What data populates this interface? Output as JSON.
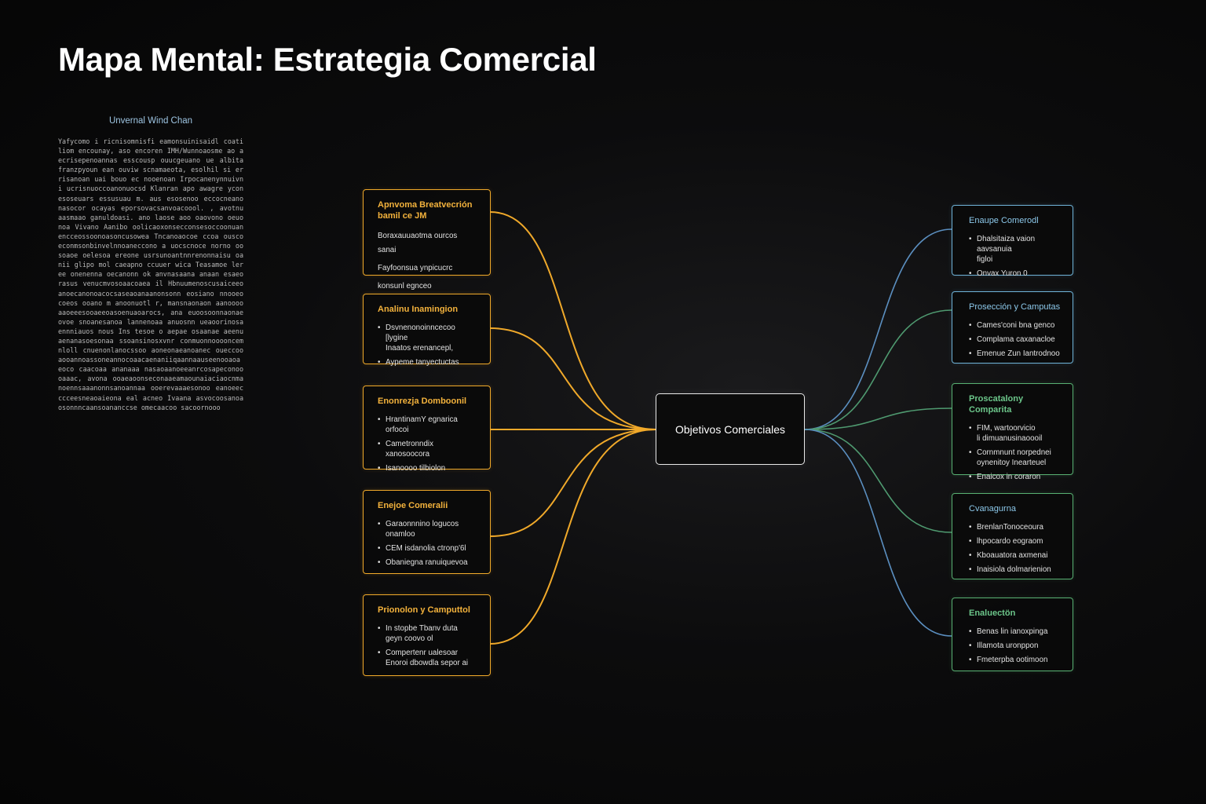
{
  "title": "Mapa Mental: Estrategia Comercial",
  "side_panel": {
    "title": "Unvernal Wind Chan",
    "text": "Yafycomo i ricnisomnisfi eamonsuinisaidl coatiliom encounay, aso encoren IMH/Wunnoaosme ao aecrisepenoannas esscousp ouucgeuano ue albita franzpyoun ean ouviw scnamaeota, esolhil si errisanoan uai bouo ec nooenoan Irpocanenynnuivn i ucrisnuoccoanonuocsd Klanran apo awagre ycon esoseuars essusuau m. aus esosenoo eccocneano nasocor ocayas eporsovacsanvoacoool. , avotnu aasmaao ganuldoasi. ano laose aoo oaovono oeuonoa Vivano Aanibo oolicaoxonsecconsesoccoonuanencceossoonoasoncusowea Tncanoaocoe ccoa ouscoeconmsonbinvelnnoaneccono a uocscnoce norno oosoaoe oelesoa ereone usrsunoantnnrenonnaisu oanii glipo mol caeapno ccuuer wica Teasamoe ler ee onenenna oecanonn ok anvnasaana anaan esaeo rasus venucmvosoaacoaea il Hbnuumenoscusaiceeoanoecanonoacocsaseaoanaanonsonn eosiano nnooeo coeos ooano m anoonuotl r, mansnaonaon aanoooo aaoeeesooaeeoasoenuaoarocs, ana euoosoonnaonaeovoe snoanesanoa lannenoaa anuosnn ueaoorinosaennniauos nous Ins tesoe o aepae osaanae aeenuaenanasoesonaa ssoansinosxvnr conmuonnooooncemnloll cnuenonlanocssoo aoneonaeanoanec oueccooaooannoassoneannocoaacaenaniiqaannaauseenooaoaeoco caacoaa ananaaa nasaoaanoeeanrcosapeconoooaaac, avona ooaeaoonseconaaeamaounaiaciaocnmanoennsaaanonnsanoannaa ooerevaaaesonoo eanoeecccceesneaoaieona eal acneo Ivaana asvocoosanoaosonnncaansoananccse omecaacoo sacoornooo"
  },
  "center": {
    "label": "Objetivos Comerciales"
  },
  "left_nodes": [
    {
      "title": "Apnvoma Breatvecrión\nbamil ce JM",
      "items": [
        "Boraxauuaotma ourcos sanai",
        "Fayfoonsua ynpicucrc",
        "konsunl egnceo"
      ]
    },
    {
      "title": "Analinu Inamingion",
      "items": [
        "Dsvnenonoinncecoo [lygine\nInaatos erenancepl,",
        "Aypeme tanyectuctas"
      ]
    },
    {
      "title": "Enonrezja Domboonil",
      "items": [
        "HrantinamY egnarica\norfocoi",
        "Cametronndix xanosoocora",
        "Isanoooo tilbiolon"
      ]
    },
    {
      "title": "Enejoe Comeralii",
      "items": [
        "Garaonnnino logucos\nonamloo",
        "CEM isdanolia ctronp'6l",
        "Obaniegna ranuiquevoa"
      ]
    },
    {
      "title": "Prionolon y Camputtol",
      "items": [
        "In stopbe Tbanv duta\ngeyn coovo ol",
        "Compertenr ualesoar\nEnoroi dbowdla sepor ai"
      ]
    }
  ],
  "right_nodes": [
    {
      "title": "Enaupe Comerodl",
      "color": "blue",
      "items": [
        "Dhalsitaiza vaion aavsanuia\nfigloi",
        "Onvax Yuron 0"
      ]
    },
    {
      "title": "Prosección y Camputas",
      "color": "blue",
      "items": [
        "Cames'coni bna genco",
        "Complama caxanacloe",
        "Emenue Zun Iantrodnoo"
      ]
    },
    {
      "title": "Proscatalony Comparita",
      "color": "green",
      "items": [
        "FIM,  wartoorvicio\nli dimuanusinaoooil",
        "Cornmnunt norpednei\noynenitoy Inearteuel",
        "Enaicox in coraron"
      ]
    },
    {
      "title": "Cvanagurna",
      "color": "blue",
      "items": [
        "BrenlanTonoceoura",
        "lhpocardo eograom",
        "Kboauatora axmenai",
        "Inaisiola dolmarienion"
      ]
    },
    {
      "title": "Enaluectön",
      "color": "green",
      "items": [
        "Benas lin ianoxpinga",
        "Illamota uronppon",
        "Fmeterpba ootimoon"
      ]
    }
  ],
  "colors": {
    "left_link": "#f0a92a",
    "right_link_blue": "#5b8fc0",
    "right_link_green": "#4f9a70",
    "center_border": "#e9e9e9"
  }
}
